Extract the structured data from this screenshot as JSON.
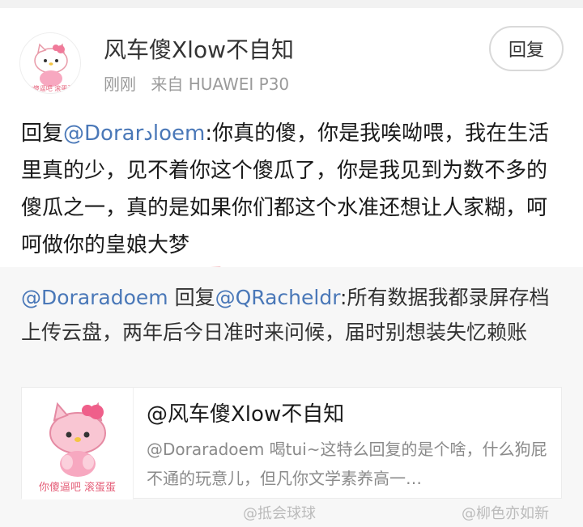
{
  "post": {
    "author": "风车傻Xlow不自知",
    "time": "刚刚",
    "source": "来自 HUAWEI P30",
    "reply_button": "回复",
    "avatar_caption": "你傻逼吧 滚蛋蛋",
    "text": {
      "prefix": "回复",
      "mention": "@Dorarادoem",
      "body": ":你真的傻，你是我唉呦喂，我在生活里真的少，见不着你这个傻瓜了，你是我见到为数不多的傻瓜之一，真的是如果你们都这个水准还想让人家糊，呵呵做你的",
      "underlined": "皇娘大梦"
    }
  },
  "quoted": {
    "mention1": "@Doraradoem",
    "reply_word": " 回复",
    "mention2": "@QRacheldr",
    "body": ":所有数据我都录屏存档上传云盘，两年后今日准时来问候，届时别想装失忆赖账"
  },
  "card": {
    "title": "@风车傻Xlow不自知",
    "body": "@Doraradoem 喝tui~这特么回复的是个啥，什么狗屁不通的玩意儿，但凡你文学素养高一…",
    "thumb_caption": "你傻逼吧 滚蛋蛋"
  },
  "watermarks": [
    "@抵会球球",
    "@柳色亦如新"
  ],
  "colors": {
    "mention": "#4a78b8",
    "underline": "#d4121b",
    "quoted_bg": "#f7f7f7"
  }
}
